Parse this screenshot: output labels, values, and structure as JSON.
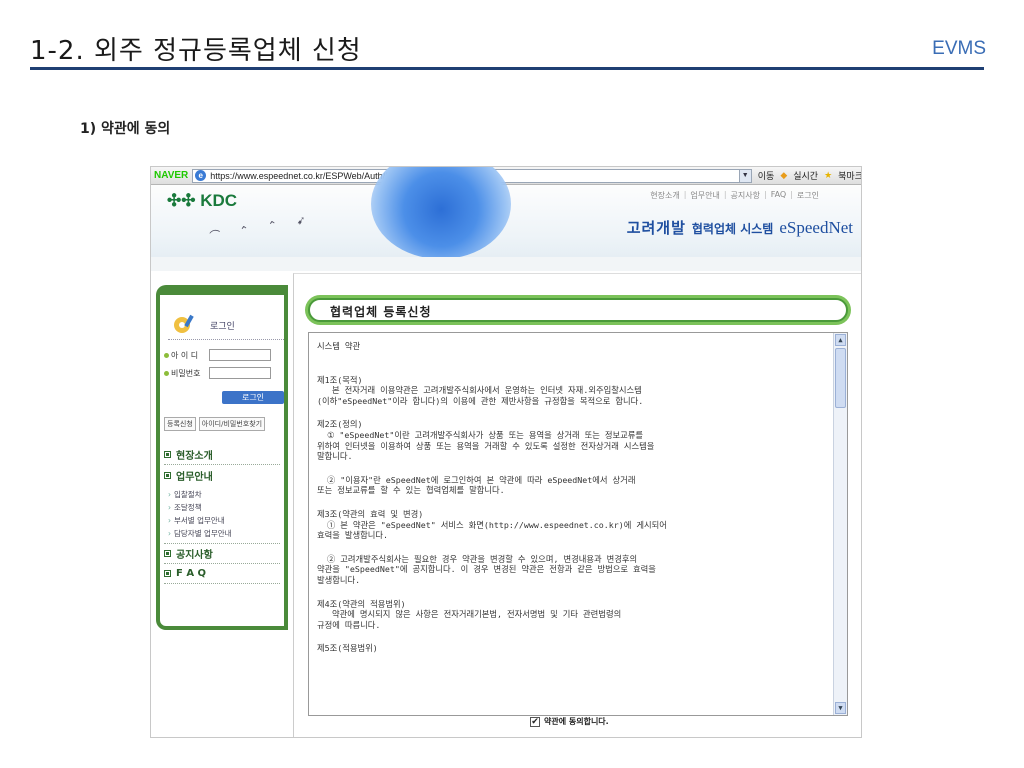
{
  "slide": {
    "title": "1-2. 외주 정규등록업체 신청",
    "brand": "EVMS",
    "section_heading": "1) 약관에 동의"
  },
  "browser": {
    "naver": "NAVER",
    "url": "https://www.espeednet.co.kr/ESPWeb/Auth/Register.aspx",
    "go": "이동",
    "realtime": "실시간",
    "bookmark": "북마크"
  },
  "site": {
    "logo": "KDC",
    "top_links": [
      "현장소개",
      "업무안내",
      "공지사항",
      "FAQ",
      "로그인"
    ],
    "brand_korean": "고려개발",
    "brand_system": "협력업체 시스템",
    "brand_english": "eSpeedNet"
  },
  "sidebar": {
    "login_title": "로그인",
    "id_label": "아 이 디",
    "pw_label": "비밀번호",
    "login_button": "로그인",
    "register_button": "등록신청",
    "find_button": "아이디/비밀번호찾기",
    "nav": [
      {
        "label": "현장소개",
        "subs": []
      },
      {
        "label": "업무안내",
        "subs": [
          "입찰절차",
          "조달정책",
          "부서별 업무안내",
          "담당자별 업무안내"
        ]
      },
      {
        "label": "공지사항",
        "subs": []
      },
      {
        "label": "F A Q",
        "subs": []
      }
    ]
  },
  "panel": {
    "title": "협력업체 등록신청",
    "terms": [
      "시스템 약관",
      "제1조(목적)\n   본 전자거래 이용약관은 고려개발주식회사에서 운영하는 인터넷 자재.외주입찰시스템\n(이하\"eSpeedNet\"이라 합니다)의 이용에 관한 제반사항을 규정함을 목적으로 합니다.",
      "제2조(정의)\n  ① \"eSpeedNet\"이란 고려개발주식회사가 상품 또는 용역을 상거래 또는 정보교류를\n위하여 인터넷을 이용하여 상품 또는 용역을 거래할 수 있도록 설정한 전자상거래 시스템을\n말합니다.",
      "  ② \"이용자\"란 eSpeedNet에 로그인하여 본 약관에 따라 eSpeedNet에서 상거래\n또는 정보교류를 할 수 있는 협력업체를 말합니다.",
      "제3조(약관의 효력 및 변경)\n  ① 본 약관은 \"eSpeedNet\" 서비스 화면(http://www.espeednet.co.kr)에 게시되어\n효력을 발생합니다.",
      "  ② 고려개발주식회사는 필요한 경우 약관을 변경할 수 있으며, 변경내용과 변경후의\n약관을 \"eSpeedNet\"에 공지합니다. 이 경우 변경된 약관은 전항과 같은 방법으로 효력을\n발생합니다.",
      "제4조(약관의 적용범위)\n   약관에 명시되지 않은 사항은 전자거래기본법, 전자서명법 및 기타 관련법령의\n규정에 따릅니다.",
      "제5조(적용범위)"
    ],
    "agree_label": "약관에 동의합니다."
  }
}
